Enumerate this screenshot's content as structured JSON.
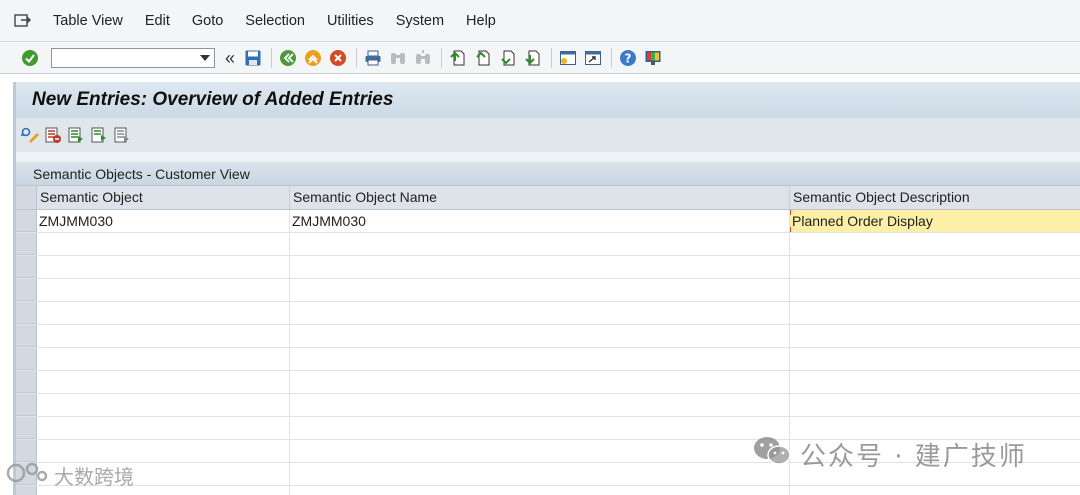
{
  "menu": {
    "items": [
      {
        "label": "Table View"
      },
      {
        "label": "Edit"
      },
      {
        "label": "Goto"
      },
      {
        "label": "Selection"
      },
      {
        "label": "Utilities"
      },
      {
        "label": "System"
      },
      {
        "label": "Help"
      }
    ]
  },
  "toolbar": {
    "command_value": "",
    "back_chevron": "«"
  },
  "title": "New Entries: Overview of Added Entries",
  "table": {
    "title": "Semantic Objects - Customer View",
    "columns": [
      "Semantic Object",
      "Semantic Object Name",
      "Semantic Object Description"
    ],
    "rows": [
      {
        "object": "ZMJMM030",
        "name": "ZMJMM030",
        "description": "Planned Order Display"
      }
    ]
  },
  "watermark": {
    "right_text": "公众号 · 建广技师",
    "left_text": "大数跨境"
  },
  "colors": {
    "accent_green": "#3f9a2f",
    "highlight": "#fdf0a6",
    "title_bg": "#d5e1eb"
  }
}
